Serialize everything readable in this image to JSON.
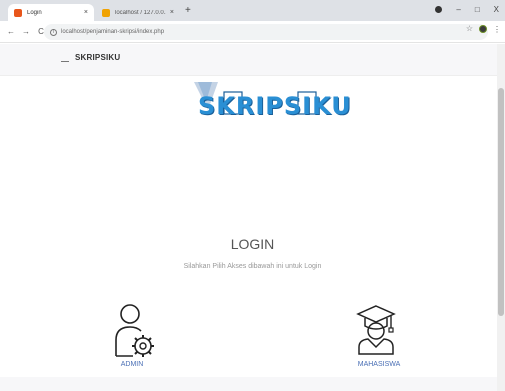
{
  "browser": {
    "tabs": [
      {
        "label": "Login",
        "active": true,
        "favicon_color": "#e8561b"
      },
      {
        "label": "localhost / 127.0.0.1 / penjaminan",
        "active": false,
        "favicon_color": "#f0a202"
      }
    ],
    "tab_close": "×",
    "new_tab": "+",
    "url": "localhost/penjaminan-skripsi/index.php",
    "nav": {
      "back": "←",
      "forward": "→",
      "reload": "C"
    },
    "window": {
      "minimize": "–",
      "restore": "□",
      "close": "X"
    }
  },
  "header": {
    "brand": "SKRIPSIKU"
  },
  "logo": {
    "text": "SKRIPSIKU",
    "color": "#2a8fd4"
  },
  "login": {
    "title": "LOGIN",
    "subtitle": "Silahkan Pilih Akses dibawah ini untuk Login"
  },
  "roles": [
    {
      "label": "ADMIN",
      "icon": "admin-gear-user-icon"
    },
    {
      "label": "MAHASISWA",
      "icon": "graduate-icon"
    }
  ],
  "colors": {
    "role_label": "#4a6fb5",
    "tabbar": "#dee1e6"
  }
}
